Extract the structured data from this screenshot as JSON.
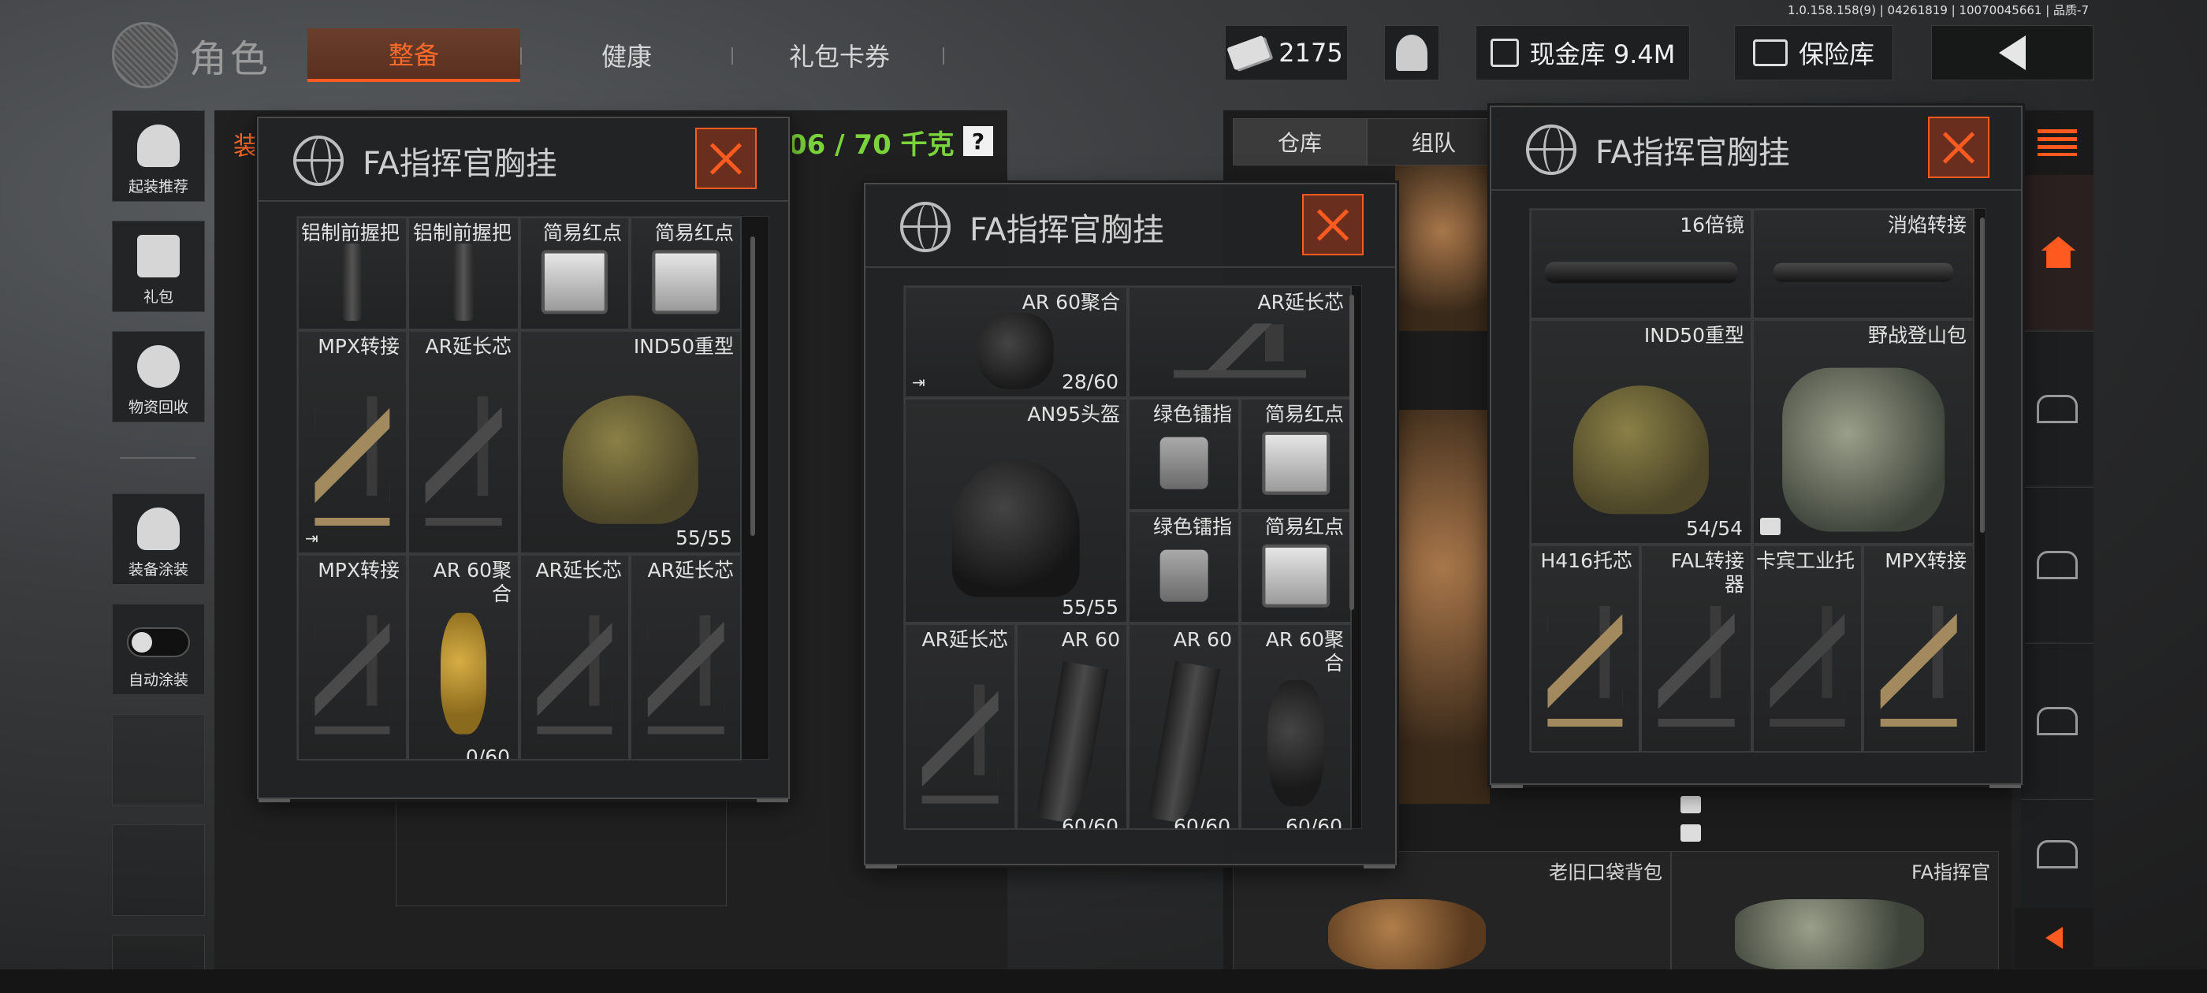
{
  "version_text": "1.0.158.158(9) | 04261819 | 10070045661 | 品质-7",
  "brand": {
    "title": "角色"
  },
  "tabs": [
    {
      "label": "整备",
      "active": true
    },
    {
      "label": "健康",
      "active": false
    },
    {
      "label": "礼包卡券",
      "active": false
    }
  ],
  "top": {
    "cash": "2175",
    "stash_value": "现金库 9.4M",
    "safe": "保险库"
  },
  "sidebar": {
    "items": [
      {
        "label": "起装推荐",
        "icon": "helmet-icon"
      },
      {
        "label": "礼包",
        "icon": "gift-icon"
      },
      {
        "label": "物资回收",
        "icon": "recycle-icon"
      },
      {
        "label": "装备涂装",
        "icon": "paint-icon"
      },
      {
        "label": "自动涂装",
        "icon": "toggle-icon"
      }
    ]
  },
  "loadout": {
    "tab_label": "装",
    "weight": "06 / 70 千克",
    "help": "?"
  },
  "warehouse": {
    "tabs": [
      "仓库",
      "组队"
    ],
    "bottom_items": [
      "老旧口袋背包",
      "FA指挥官"
    ]
  },
  "windows": [
    {
      "title": "FA指挥官胸挂",
      "cells": [
        {
          "name": "铝制前握把",
          "count": ""
        },
        {
          "name": "铝制前握把",
          "count": ""
        },
        {
          "name": "简易红点",
          "count": ""
        },
        {
          "name": "简易红点",
          "count": ""
        },
        {
          "name": "MPX转接",
          "count": ""
        },
        {
          "name": "AR延长芯",
          "count": ""
        },
        {
          "name": "IND50重型",
          "count": "55/55"
        },
        {
          "name": "MPX转接",
          "count": ""
        },
        {
          "name": "AR 60聚合",
          "count": "0/60"
        },
        {
          "name": "AR延长芯",
          "count": ""
        },
        {
          "name": "AR延长芯",
          "count": ""
        }
      ]
    },
    {
      "title": "FA指挥官胸挂",
      "cells": [
        {
          "name": "AR 60聚合",
          "count": "28/60"
        },
        {
          "name": "AR延长芯",
          "count": ""
        },
        {
          "name": "AN95头盔",
          "count": "55/55"
        },
        {
          "name": "绿色镭指",
          "count": ""
        },
        {
          "name": "简易红点",
          "count": ""
        },
        {
          "name": "绿色镭指",
          "count": ""
        },
        {
          "name": "简易红点",
          "count": ""
        },
        {
          "name": "AR延长芯",
          "count": ""
        },
        {
          "name": "AR 60",
          "count": "60/60"
        },
        {
          "name": "AR 60",
          "count": "60/60"
        },
        {
          "name": "AR 60聚合",
          "count": "60/60"
        }
      ]
    },
    {
      "title": "FA指挥官胸挂",
      "cells": [
        {
          "name": "16倍镜",
          "count": ""
        },
        {
          "name": "消焰转接",
          "count": ""
        },
        {
          "name": "IND50重型",
          "count": "54/54"
        },
        {
          "name": "野战登山包",
          "count": ""
        },
        {
          "name": "H416托芯",
          "count": ""
        },
        {
          "name": "FAL转接器",
          "count": ""
        },
        {
          "name": "卡宾工业托",
          "count": ""
        },
        {
          "name": "MPX转接",
          "count": ""
        }
      ]
    }
  ]
}
